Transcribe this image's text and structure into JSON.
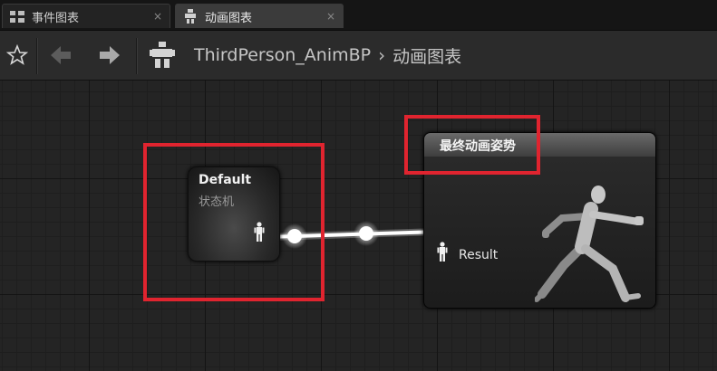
{
  "tabs": [
    {
      "label": "事件图表",
      "active": false,
      "icon": "event-graph-icon"
    },
    {
      "label": "动画图表",
      "active": true,
      "icon": "anim-graph-icon"
    }
  ],
  "tab_close_glyph": "×",
  "toolbar": {
    "breadcrumb": [
      "ThirdPerson_AnimBP",
      "动画图表"
    ],
    "breadcrumb_separator": "›"
  },
  "nodes": {
    "state_machine": {
      "title": "Default",
      "subtitle": "状态机"
    },
    "output_pose": {
      "title": "最终动画姿势",
      "pin_label": "Result"
    }
  },
  "colors": {
    "highlight": "#e0242f",
    "wire": "#ffffff"
  }
}
